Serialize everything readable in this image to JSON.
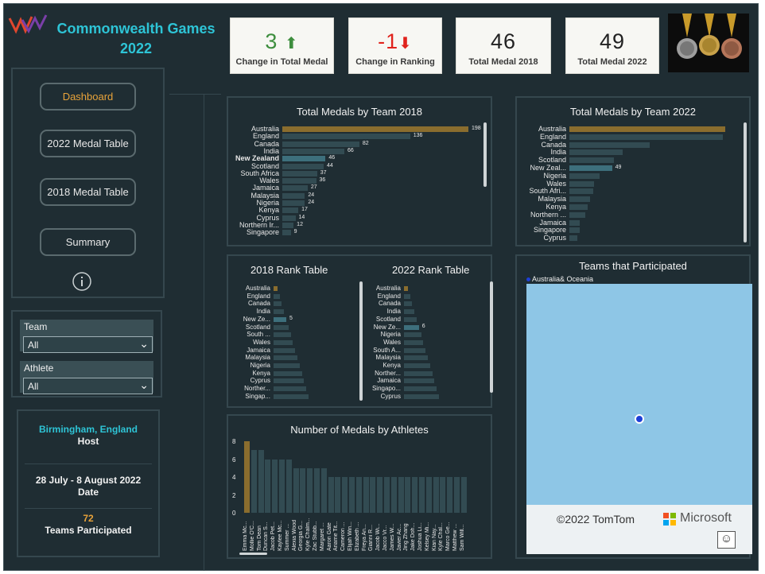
{
  "header": {
    "title_line1": "Commonwealth Games",
    "title_line2": "2022"
  },
  "kpis": [
    {
      "value": "3",
      "arrow": "⬆",
      "label": "Change in Total Medal",
      "color": "#3e8e3e"
    },
    {
      "value": "-1",
      "arrow": "⬇",
      "label": "Change in Ranking",
      "color": "#e0221c"
    },
    {
      "value": "46",
      "arrow": "",
      "label": "Total Medal 2018",
      "color": "#222222"
    },
    {
      "value": "49",
      "arrow": "",
      "label": "Total Medal 2022",
      "color": "#222222"
    }
  ],
  "nav": {
    "dashboard": "Dashboard",
    "medal_2022": "2022 Medal Table",
    "medal_2018": "2018 Medal Table",
    "summary": "Summary",
    "info_icon": "info-icon"
  },
  "filters": {
    "team_label": "Team",
    "team_value": "All",
    "athlete_label": "Athlete",
    "athlete_value": "All"
  },
  "info": {
    "host_value": "Birmingham, England",
    "host_label": "Host",
    "date_value": "28 July - 8 August 2022",
    "date_label": "Date",
    "teams_value": "72",
    "teams_label": "Teams Participated"
  },
  "colors": {
    "accent_cyan": "#2ec4d6",
    "accent_orange": "#e8a33a",
    "gold_bar": "#8a6d2e",
    "bar": "#324b52",
    "highlight_bar": "#3d6f7c",
    "map_water": "#8ec6e6"
  },
  "chart_data": [
    {
      "type": "bar",
      "title": "Total Medals by Team 2018",
      "categories": [
        "Australia",
        "England",
        "Canada",
        "India",
        "New Zealand",
        "Scotland",
        "South Africa",
        "Wales",
        "Jamaica",
        "Malaysia",
        "Nigeria",
        "Kenya",
        "Cyprus",
        "Northern Ir...",
        "Singapore"
      ],
      "values": [
        198,
        136,
        82,
        66,
        46,
        44,
        37,
        36,
        27,
        24,
        24,
        17,
        14,
        12,
        9
      ],
      "highlight": "New Zealand"
    },
    {
      "type": "bar",
      "title": "Total Medals by Team 2022",
      "categories": [
        "Australia",
        "England",
        "Canada",
        "India",
        "Scotland",
        "New Zeal...",
        "Nigeria",
        "Wales",
        "South Afri...",
        "Malaysia",
        "Kenya",
        "Northern ...",
        "Jamaica",
        "Singapore",
        "Cyprus"
      ],
      "values": [
        179,
        176,
        92,
        61,
        51,
        49,
        35,
        28,
        27,
        24,
        21,
        18,
        12,
        12,
        9
      ],
      "labels": {
        "New Zeal...": 49
      },
      "highlight": "New Zeal..."
    },
    {
      "type": "bar",
      "title": "2018 Rank Table",
      "categories": [
        "Australia",
        "England",
        "Canada",
        "India",
        "New Ze...",
        "Scotland",
        "South ...",
        "Wales",
        "Jamaica",
        "Malaysia",
        "Nigeria",
        "Kenya",
        "Cyprus",
        "Norther...",
        "Singap..."
      ],
      "values": [
        1,
        2,
        3,
        4,
        5,
        6,
        7,
        8,
        9,
        10,
        11,
        12,
        13,
        14,
        15
      ],
      "labels": {
        "New Ze...": 5
      },
      "highlight": "New Ze..."
    },
    {
      "type": "bar",
      "title": "2022 Rank Table",
      "categories": [
        "Australia",
        "England",
        "Canada",
        "India",
        "Scotland",
        "New Ze...",
        "Nigeria",
        "Wales",
        "South A...",
        "Malaysia",
        "Kenya",
        "Norther...",
        "Jamaica",
        "Singapo...",
        "Cyprus"
      ],
      "values": [
        1,
        2,
        3,
        4,
        5,
        6,
        7,
        8,
        9,
        10,
        11,
        12,
        13,
        14,
        15
      ],
      "labels": {
        "New Ze...": 6
      },
      "highlight": "New Ze..."
    },
    {
      "type": "bar",
      "title": "Number of Medals by Athletes",
      "ylim": [
        0,
        8
      ],
      "yticks": [
        0,
        2,
        4,
        6,
        8
      ],
      "categories": [
        "Emma Mc...",
        "Mollie O'C...",
        "Tom Dean",
        "Duncan S...",
        "Jacob Pet...",
        "Kaylee Mc...",
        "Summer ...",
        "Alexia Wood",
        "Georgia G...",
        "Kyle Chalm...",
        "Zac Stubb...",
        "Margaret ...",
        "Aaron Gate",
        "Ariarne Tit...",
        "Cameron ...",
        "Elijah Win...",
        "Elizabeth ...",
        "Freya An...",
        "Gianni R...",
        "Jacob Wi...",
        "Jacco Vr...",
        "James W...",
        "Javier Ac...",
        "Jing Zhang",
        "Jake Doh...",
        "Joshua Li...",
        "Kelsey Mi...",
        "Kian Nay...",
        "Kyle Chal...",
        "Marco Ge...",
        "Matthew ...",
        "Sam Will..."
      ],
      "values": [
        8,
        7,
        7,
        6,
        6,
        6,
        6,
        5,
        5,
        5,
        5,
        5,
        4,
        4,
        4,
        4,
        4,
        4,
        4,
        4,
        4,
        4,
        4,
        4,
        4,
        4,
        4,
        4,
        4,
        4,
        4,
        4
      ]
    }
  ],
  "map": {
    "title": "Teams that Participated",
    "legend": "Australia& Oceania",
    "copyright": "©2022 TomTom",
    "brand": "Microsoft"
  }
}
